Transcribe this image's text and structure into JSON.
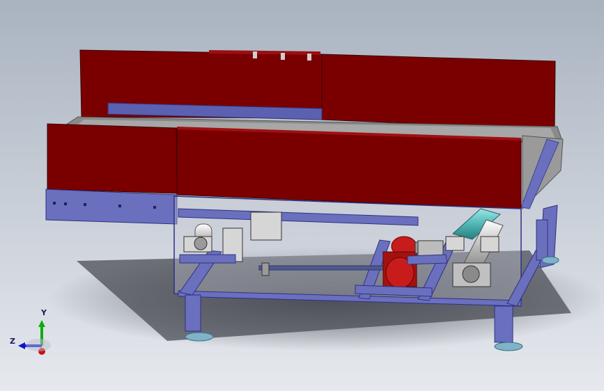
{
  "viewport": {
    "background_top": "#a9b3c0",
    "background_bottom": "#e6e9ee"
  },
  "model": {
    "colors": {
      "guard_red": "#7a0000",
      "guard_red_edge": "#4a0000",
      "frame_blue": "#6a6fbe",
      "frame_blue_dark": "#3f4490",
      "belt_gray": "#8a8a8a",
      "belt_light": "#b8b8b8",
      "motor_red": "#c81c1c",
      "roller_teal": "#4fb6b6",
      "metal_light": "#d6d6d6",
      "foot_blue": "#7fb3c9",
      "shadow": "#5b5e66"
    },
    "parts": [
      "guard-back-left",
      "guard-back-right",
      "guard-front-left",
      "guard-front-right",
      "conveyor-belt",
      "side-frame",
      "lower-frame",
      "drive-motor",
      "tension-roller",
      "bearing-block",
      "support-leg",
      "leveling-foot"
    ]
  },
  "triad": {
    "x_label": "",
    "y_label": "Y",
    "z_label": "Z",
    "x_color": "#cc1111",
    "y_color": "#11aa11",
    "z_color": "#1111cc"
  }
}
